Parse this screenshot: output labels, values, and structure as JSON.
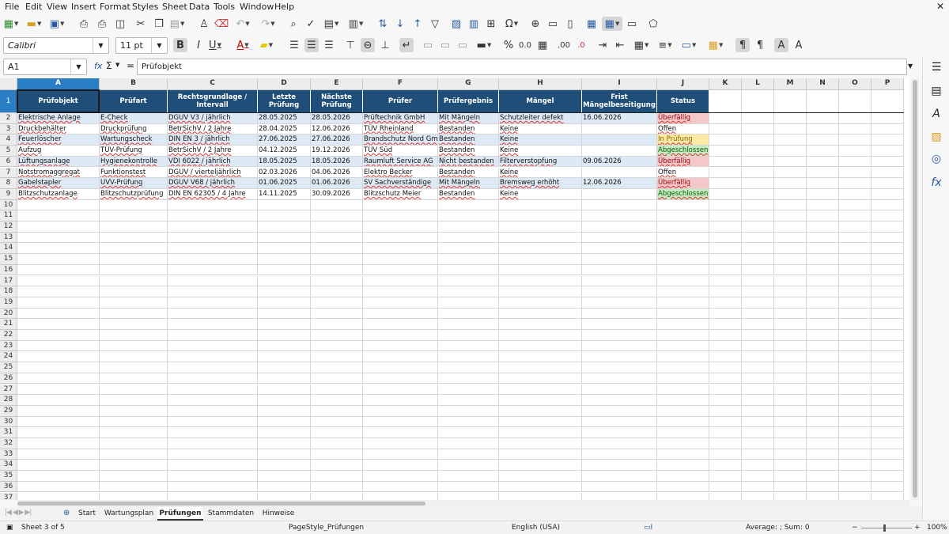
{
  "menu": [
    "File",
    "Edit",
    "View",
    "Insert",
    "Format",
    "Styles",
    "Sheet",
    "Data",
    "Tools",
    "Window",
    "Help"
  ],
  "font": {
    "name": "Calibri",
    "size": "11 pt"
  },
  "namebox": "A1",
  "formula": "Prüfobjekt",
  "formula_symbols": {
    "fx": "fx",
    "sigma": "Σ",
    "equals": "="
  },
  "columns": [
    "A",
    "B",
    "C",
    "D",
    "E",
    "F",
    "G",
    "H",
    "I",
    "J",
    "K",
    "L",
    "M",
    "N",
    "O",
    "P"
  ],
  "rows": [
    "1",
    "2",
    "3",
    "4",
    "5",
    "6",
    "7",
    "8",
    "9",
    "10",
    "11",
    "12",
    "13",
    "14",
    "15",
    "16",
    "17",
    "18",
    "19",
    "20",
    "21",
    "22",
    "23",
    "24",
    "25",
    "26",
    "27",
    "28",
    "29",
    "30",
    "31",
    "32",
    "33",
    "34",
    "35",
    "36",
    "37"
  ],
  "headers": [
    "Prüfobjekt",
    "Prüfart",
    "Rechtsgrundlage / Intervall",
    "Letzte Prüfung",
    "Nächste Prüfung",
    "Prüfer",
    "Prüfergebnis",
    "Mängel",
    "Frist Mängelbeseitigung",
    "Status"
  ],
  "data": [
    [
      "Elektrische Anlage",
      "E-Check",
      "DGUV V3 / jährlich",
      "28.05.2025",
      "28.05.2026",
      "Prüftechnik GmbH",
      "Mit Mängeln",
      "Schutzleiter defekt",
      "16.06.2026",
      "Überfällig"
    ],
    [
      "Druckbehälter",
      "Druckprüfung",
      "BetrSichV / 2 Jahre",
      "28.04.2025",
      "12.06.2026",
      "TÜV Rheinland",
      "Bestanden",
      "Keine",
      "",
      "Offen"
    ],
    [
      "Feuerlöscher",
      "Wartungscheck",
      "DIN EN 3 / jährlich",
      "27.06.2025",
      "27.06.2026",
      "Brandschutz Nord GmbH",
      "Bestanden",
      "Keine",
      "",
      "In Prüfung"
    ],
    [
      "Aufzug",
      "TÜV-Prüfung",
      "BetrSichV / 2 Jahre",
      "04.12.2025",
      "19.12.2026",
      "TÜV Süd",
      "Bestanden",
      "Keine",
      "",
      "Abgeschlossen"
    ],
    [
      "Lüftungsanlage",
      "Hygienekontrolle",
      "VDI 6022 / jährlich",
      "18.05.2025",
      "18.05.2026",
      "Raumluft Service AG",
      "Nicht bestanden",
      "Filterverstopfung",
      "09.06.2026",
      "Überfällig"
    ],
    [
      "Notstromaggregat",
      "Funktionstest",
      "DGUV / vierteljährlich",
      "02.03.2026",
      "04.06.2026",
      "Elektro Becker",
      "Bestanden",
      "Keine",
      "",
      "Offen"
    ],
    [
      "Gabelstapler",
      "UVV-Prüfung",
      "DGUV V68 / jährlich",
      "01.06.2025",
      "01.06.2026",
      "SV Sachverständige",
      "Mit Mängeln",
      "Bremsweg erhöht",
      "12.06.2026",
      "Überfällig"
    ],
    [
      "Blitzschutzanlage",
      "Blitzschutzprüfung",
      "DIN EN 62305 / 4 Jahre",
      "14.11.2025",
      "30.09.2026",
      "Blitzschutz Meier",
      "Bestanden",
      "Keine",
      "",
      "Abgeschlossen"
    ]
  ],
  "status_colors": {
    "Überfällig": "#f4c7c9",
    "Offen": "#ffffff",
    "In Prüfung": "#fde9a6",
    "Abgeschlossen": "#c9e8c4"
  },
  "status_text_colors": {
    "Überfällig": "#9c0006",
    "Offen": "#111111",
    "In Prüfung": "#8a6400",
    "Abgeschlossen": "#006100"
  },
  "sheet_tabs": [
    "Start",
    "Wartungsplan",
    "Prüfungen",
    "Stammdaten",
    "Hinweise"
  ],
  "active_tab": "Prüfungen",
  "status": {
    "sheet": "Sheet 3 of 5",
    "pagestyle": "PageStyle_Prüfungen",
    "language": "English (USA)",
    "sum": "Average: ; Sum: 0",
    "zoom": "100%"
  },
  "colors": {
    "header_fill": "#1f4e79",
    "band_fill": "#dde9f5",
    "selection": "#2a7fc4"
  }
}
